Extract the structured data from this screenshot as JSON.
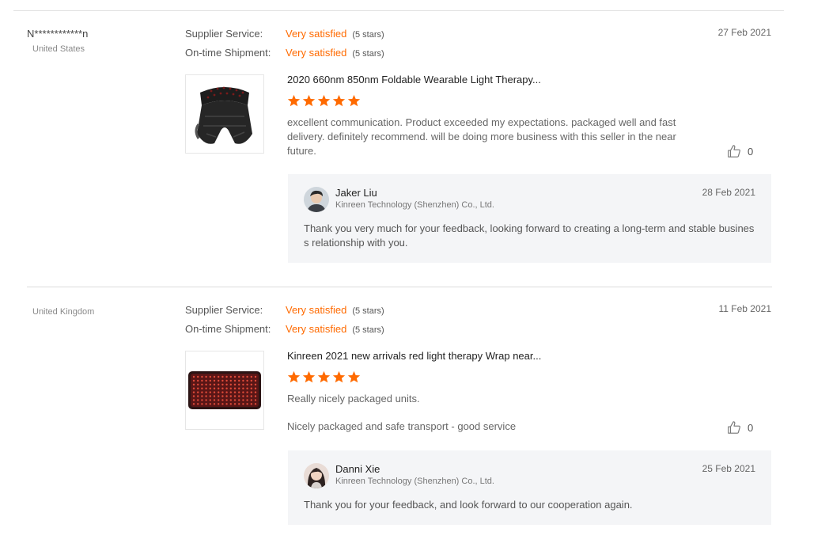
{
  "colors": {
    "accent": "#ff6a00",
    "reply_bg": "#f4f5f7"
  },
  "reviews": [
    {
      "user_name": "N************n",
      "country": "United States",
      "supplier_label": "Supplier Service:",
      "supplier_value": "Very satisfied",
      "supplier_stars": "(5 stars)",
      "shipment_label": "On-time Shipment:",
      "shipment_value": "Very satisfied",
      "shipment_stars": "(5 stars)",
      "date": "27 Feb 2021",
      "product_title": "2020 660nm 850nm Foldable Wearable Light Therapy...",
      "product_icon": "led-neck-wrap-icon",
      "rating": 5,
      "text": "excellent communication. Product exceeded my expectations. packaged well and fast delivery. definitely recommend. will be doing more business with this seller in the near future.",
      "likes": "0",
      "reply": {
        "name": "Jaker Liu",
        "company": "Kinreen Technology (Shenzhen) Co., Ltd.",
        "date": "28 Feb 2021",
        "text": "Thank you very much for your feedback, looking forward to creating a long-term and stable business relationship with you."
      }
    },
    {
      "user_name": "",
      "country": "United Kingdom",
      "supplier_label": "Supplier Service:",
      "supplier_value": "Very satisfied",
      "supplier_stars": "(5 stars)",
      "shipment_label": "On-time Shipment:",
      "shipment_value": "Very satisfied",
      "shipment_stars": "(5 stars)",
      "date": "11 Feb 2021",
      "product_title": "Kinreen 2021 new arrivals red light therapy Wrap near...",
      "product_icon": "led-pad-icon",
      "rating": 5,
      "text": "Really nicely packaged units.",
      "text2": "Nicely packaged and safe transport - good service",
      "likes": "0",
      "reply": {
        "name": "Danni Xie",
        "company": "Kinreen Technology (Shenzhen) Co., Ltd.",
        "date": "25 Feb 2021",
        "text": "Thank you for your feedback, and look forward to our cooperation again."
      }
    }
  ]
}
